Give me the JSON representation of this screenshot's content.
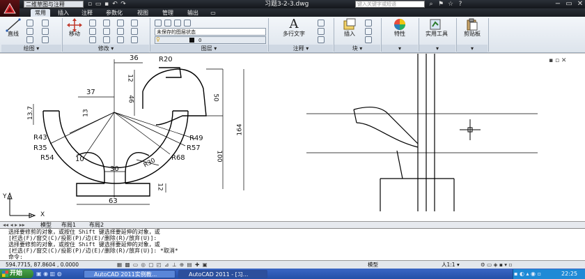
{
  "window": {
    "workspace": "二维草图与注释",
    "doc_title": "习题3-2-3.dwg",
    "search_placeholder": "键入关键字或短语",
    "controls": [
      "−",
      "▭",
      "✕"
    ]
  },
  "tabs": [
    {
      "label": "常用",
      "active": true
    },
    {
      "label": "插入"
    },
    {
      "label": "注释"
    },
    {
      "label": "参数化"
    },
    {
      "label": "视图"
    },
    {
      "label": "管理"
    },
    {
      "label": "输出"
    }
  ],
  "ribbon": {
    "draw": {
      "line": "直线",
      "panel": "绘图 ▾"
    },
    "modify": {
      "move": "移动",
      "panel": "修改 ▾"
    },
    "layers": {
      "state": "未保存的图层状态",
      "current": "0",
      "panel": "图层 ▾"
    },
    "annotation": {
      "mtext": "多行文字",
      "panel": "注释 ▾"
    },
    "block": {
      "insert": "插入",
      "panel": "块 ▾"
    },
    "properties": {
      "label": "特性",
      "panel": "▾"
    },
    "utilities": {
      "label": "实用工具",
      "panel": "▾"
    },
    "clipboard": {
      "label": "剪贴板",
      "panel": "▾"
    }
  },
  "drawing": {
    "dims": [
      "36",
      "R20",
      "12",
      "37",
      "46",
      "50",
      "13.7",
      "13",
      "R43",
      "R49",
      "R35",
      "R57",
      "164",
      "R54",
      "R68",
      "10",
      "R30",
      "100",
      "30",
      "12",
      "63"
    ],
    "ucs": {
      "y": "Y",
      "x": "X"
    }
  },
  "layout_tabs": [
    "模型",
    "布局1",
    "布局2"
  ],
  "command_lines": [
    "选择要修剪的对象，或按住 Shift 键选择要延伸的对象，或",
    "[栏选(F)/窗交(C)/投影(P)/边(E)/删除(R)/放弃(U)]:",
    "选择要修剪的对象，或按住 Shift 键选择要延伸的对象，或",
    "[栏选(F)/窗交(C)/投影(P)/边(E)/删除(R)/放弃(U)]: *取消*",
    "命令:"
  ],
  "status": {
    "coords": "594.7715, 87.8604 , 0.0000",
    "model": "模型",
    "scale": "人1:1 ▾"
  },
  "taskbar": {
    "start": "开始",
    "items": [
      "AutoCAD 2011实例教...",
      "AutoCAD 2011 - [习..."
    ],
    "clock": "22:25"
  },
  "colors": {
    "title": "#1a1d22",
    "ribbon": "#e6ecf3",
    "app_red": "#b01c22",
    "taskbar": "#2f5cb8"
  }
}
